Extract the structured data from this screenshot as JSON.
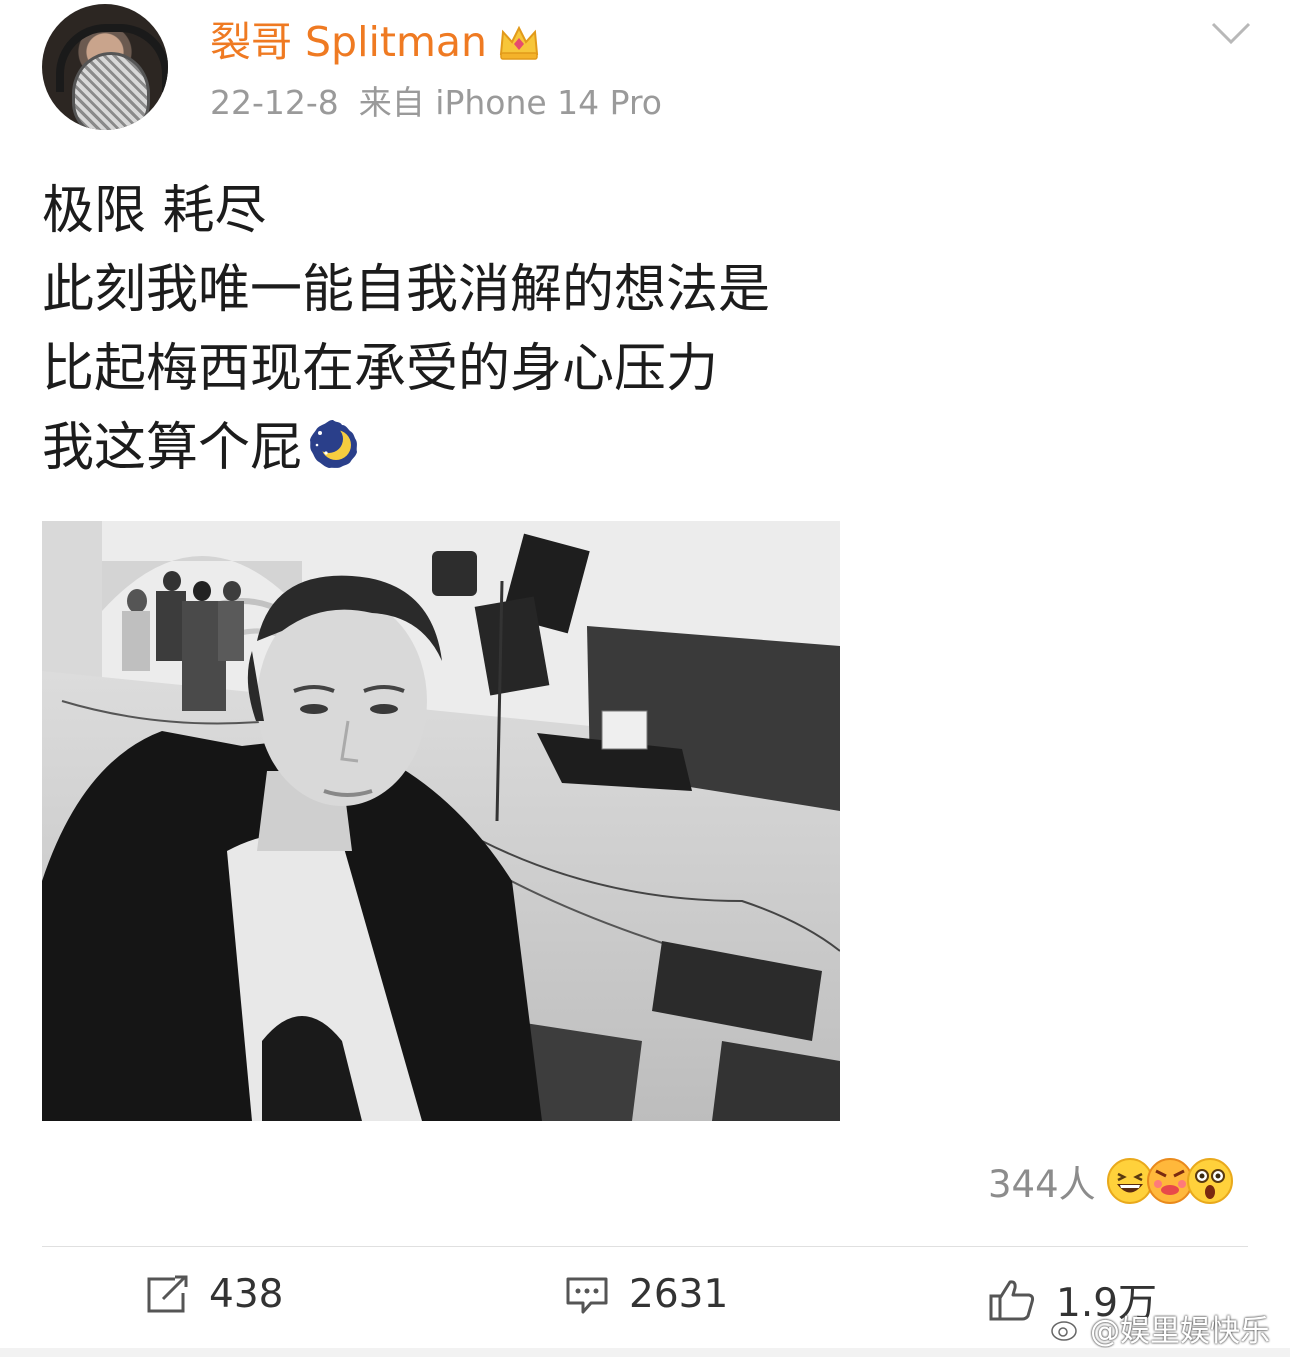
{
  "post": {
    "author": "裂哥 Splitman",
    "date": "22-12-8",
    "source": "来自 iPhone 14 Pro",
    "text_lines": [
      "极限 耗尽",
      "此刻我唯一能自我消解的想法是",
      "比起梅西现在承受的身心压力",
      "我这算个屁"
    ],
    "emojis": {
      "inline": "moon-emoji",
      "reactions": [
        "laughing-emoji",
        "angry-emoji",
        "surprised-emoji"
      ]
    }
  },
  "reactions": {
    "count_label": "344人"
  },
  "actions": {
    "repost_count": "438",
    "comment_count": "2631",
    "like_count": "1.9万"
  },
  "watermark": "@娱里娱快乐",
  "colors": {
    "author_name": "#ef7a22",
    "meta_text": "#9a9a9a",
    "divider": "#e0e0e0"
  },
  "icons": [
    "crown-icon",
    "chevron-down-icon",
    "repost-icon",
    "comment-icon",
    "like-icon",
    "weibo-logo-icon"
  ]
}
